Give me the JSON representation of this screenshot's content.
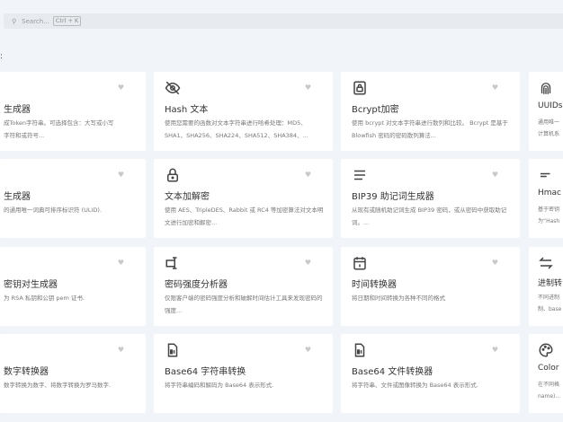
{
  "search": {
    "placeholder": "Search...",
    "shortcut": "Ctrl + K",
    "icon": "search-icon"
  },
  "section": {
    "label": ":"
  },
  "colors": {
    "background": "#f1f4f8",
    "card": "#ffffff",
    "heart": "#c8c8c8"
  },
  "cards": [
    {
      "col": 1,
      "row": 1,
      "icon": "",
      "title": "生成器",
      "desc": "成Token字符串。可选择包含：大写或小写字符和或符号..."
    },
    {
      "col": 2,
      "row": 1,
      "icon": "eye-off-icon",
      "title": "Hash 文本",
      "desc": "使用您需要的函数对文本字符串进行哈希处理：MD5、SHA1、SHA256、SHA224、SHA512、SHA384、..."
    },
    {
      "col": 3,
      "row": 1,
      "icon": "lock-square-icon",
      "title": "Bcrypt加密",
      "desc": "使用 bcrypt 对文本字符串进行散列和比较。 Bcrypt 是基于 Blowfish 密码的密码散列算法..."
    },
    {
      "col": 4,
      "row": 1,
      "icon": "fingerprint-icon",
      "title": "UUIDs",
      "desc": "通用唯一 计算机系"
    },
    {
      "col": 1,
      "row": 2,
      "icon": "",
      "title": "生成器",
      "desc": "的通用唯一词典可排序标识符 (ULID)."
    },
    {
      "col": 2,
      "row": 2,
      "icon": "lock-icon",
      "title": "文本加解密",
      "desc": "使用 AES、TripleDES、Rabbit 或 RC4 等加密算法对文本明文进行加密和解密..."
    },
    {
      "col": 3,
      "row": 2,
      "icon": "align-justify-icon",
      "title": "BIP39 助记词生成器",
      "desc": "从现有或随机助记词生成 BIP39 密码，或从密码中获取助记词。..."
    },
    {
      "col": 4,
      "row": 2,
      "icon": "short-text-icon",
      "title": "Hmac",
      "desc": "基于密钥 为“Hash"
    },
    {
      "col": 1,
      "row": 3,
      "icon": "",
      "title": "密钥对生成器",
      "desc": "为 RSA 私钥和公钥 pem 证书."
    },
    {
      "col": 2,
      "row": 3,
      "icon": "password-icon",
      "title": "密码强度分析器",
      "desc": "仅限客户端的密码强度分析和破解时间估计工具来发现密码的强度..."
    },
    {
      "col": 3,
      "row": 3,
      "icon": "calendar-icon",
      "title": "时间转换器",
      "desc": "将日期和时间转换为各种不同的格式"
    },
    {
      "col": 4,
      "row": 3,
      "icon": "arrows-exchange-icon",
      "title": "进制转",
      "desc": "不同进制 制、base"
    },
    {
      "col": 1,
      "row": 4,
      "icon": "",
      "title": "数字转换器",
      "desc": "数字转换为数字、将数字转换为罗马数字."
    },
    {
      "col": 2,
      "row": 4,
      "icon": "file-binary-icon",
      "title": "Base64 字符串转换",
      "desc": "将字符串编码和解码为 Base64 表示形式."
    },
    {
      "col": 3,
      "row": 4,
      "icon": "file-binary-icon",
      "title": "Base64 文件转换器",
      "desc": "将字符串、文件或图像转换为 Base64 表示形式."
    },
    {
      "col": 4,
      "row": 4,
      "icon": "palette-icon",
      "title": "Color",
      "desc": "在不同格 name)..."
    }
  ]
}
